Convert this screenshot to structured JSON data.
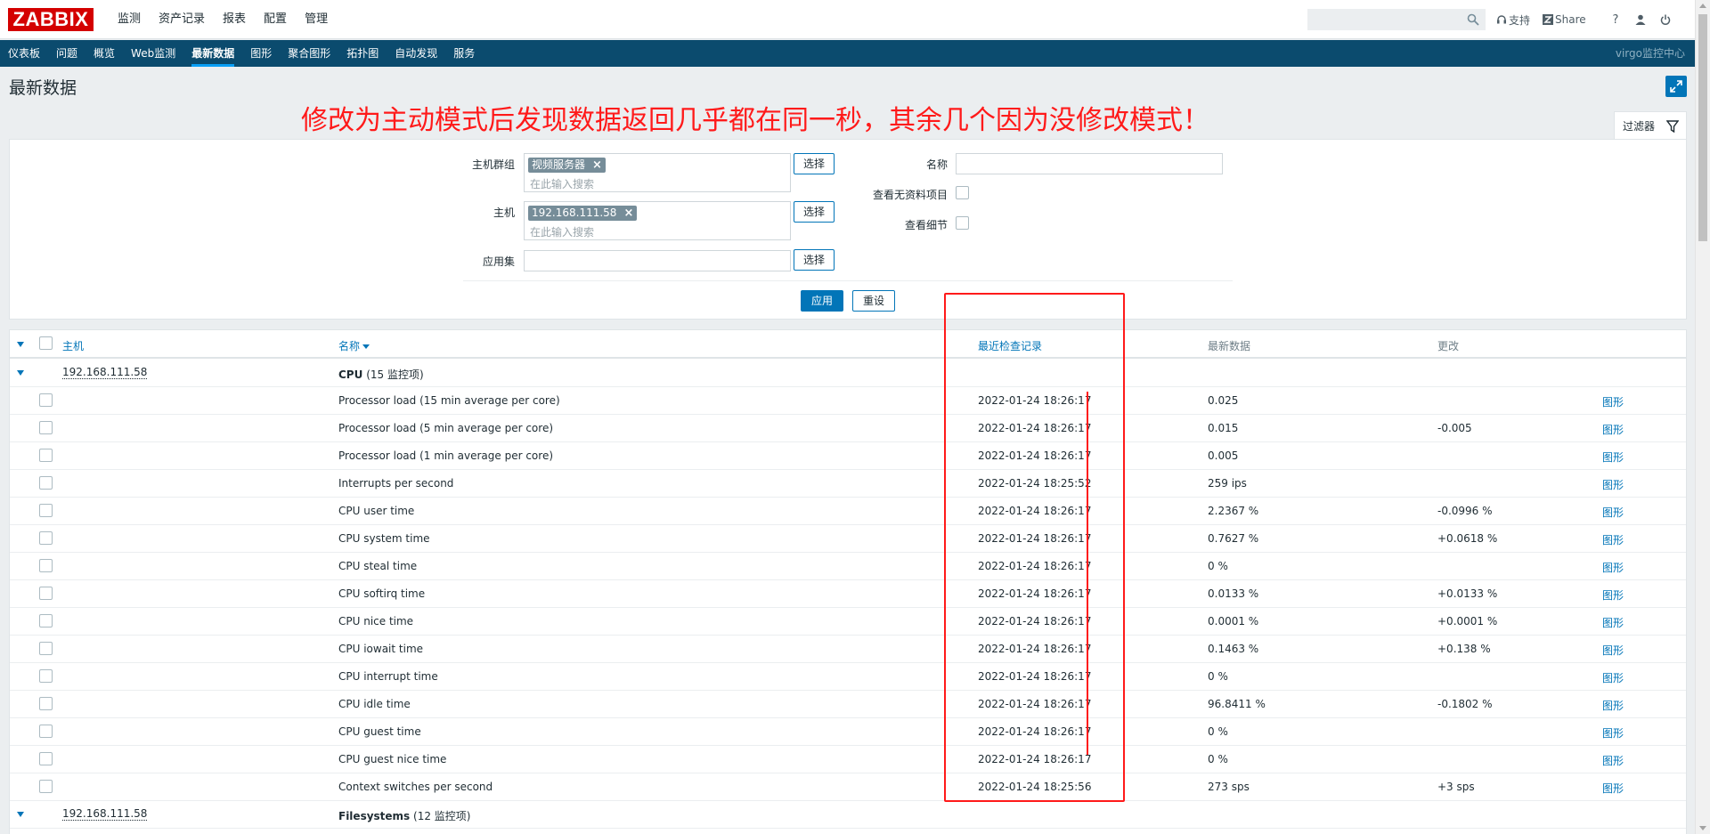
{
  "header": {
    "logo": "ZABBIX",
    "menu": [
      "监测",
      "资产记录",
      "报表",
      "配置",
      "管理"
    ],
    "search_placeholder": "",
    "links": {
      "support": "支持",
      "share": "Share"
    },
    "icons": {
      "help": "?"
    }
  },
  "subnav": {
    "items": [
      "仪表板",
      "问题",
      "概览",
      "Web监测",
      "最新数据",
      "图形",
      "聚合图形",
      "拓扑图",
      "自动发现",
      "服务"
    ],
    "active_index": 4,
    "server_name": "virgo监控中心"
  },
  "page": {
    "title": "最新数据",
    "annotation": "修改为主动模式后发现数据返回几乎都在同一秒，其余几个因为没修改模式！"
  },
  "filter": {
    "tab_label": "过滤器",
    "host_group_label": "主机群组",
    "host_group_chip": "视频服务器",
    "host_label": "主机",
    "host_chip": "192.168.111.58",
    "search_placeholder": "在此输入搜索",
    "app_label": "应用集",
    "select_label": "选择",
    "name_label": "名称",
    "show_without_data_label": "查看无资料项目",
    "show_details_label": "查看细节",
    "apply_label": "应用",
    "reset_label": "重设"
  },
  "table": {
    "columns": {
      "host": "主机",
      "name": "名称",
      "last_check": "最近检查记录",
      "last_value": "最新数据",
      "change": "更改"
    },
    "group1": {
      "host": "192.168.111.58",
      "app_name": "CPU",
      "app_count": "(15 监控项)"
    },
    "group2": {
      "host": "192.168.111.58",
      "app_name": "Filesystems",
      "app_count": "(12 监控项)"
    },
    "graph_label": "图形",
    "rows": [
      {
        "name": "Processor load (15 min average per core)",
        "time": "2022-01-24 18:26:17",
        "value": "0.025",
        "change": ""
      },
      {
        "name": "Processor load (5 min average per core)",
        "time": "2022-01-24 18:26:17",
        "value": "0.015",
        "change": "-0.005"
      },
      {
        "name": "Processor load (1 min average per core)",
        "time": "2022-01-24 18:26:17",
        "value": "0.005",
        "change": ""
      },
      {
        "name": "Interrupts per second",
        "time": "2022-01-24 18:25:52",
        "value": "259 ips",
        "change": ""
      },
      {
        "name": "CPU user time",
        "time": "2022-01-24 18:26:17",
        "value": "2.2367 %",
        "change": "-0.0996 %"
      },
      {
        "name": "CPU system time",
        "time": "2022-01-24 18:26:17",
        "value": "0.7627 %",
        "change": "+0.0618 %"
      },
      {
        "name": "CPU steal time",
        "time": "2022-01-24 18:26:17",
        "value": "0 %",
        "change": ""
      },
      {
        "name": "CPU softirq time",
        "time": "2022-01-24 18:26:17",
        "value": "0.0133 %",
        "change": "+0.0133 %"
      },
      {
        "name": "CPU nice time",
        "time": "2022-01-24 18:26:17",
        "value": "0.0001 %",
        "change": "+0.0001 %"
      },
      {
        "name": "CPU iowait time",
        "time": "2022-01-24 18:26:17",
        "value": "0.1463 %",
        "change": "+0.138 %"
      },
      {
        "name": "CPU interrupt time",
        "time": "2022-01-24 18:26:17",
        "value": "0 %",
        "change": ""
      },
      {
        "name": "CPU idle time",
        "time": "2022-01-24 18:26:17",
        "value": "96.8411 %",
        "change": "-0.1802 %"
      },
      {
        "name": "CPU guest time",
        "time": "2022-01-24 18:26:17",
        "value": "0 %",
        "change": ""
      },
      {
        "name": "CPU guest nice time",
        "time": "2022-01-24 18:26:17",
        "value": "0 %",
        "change": ""
      },
      {
        "name": "Context switches per second",
        "time": "2022-01-24 18:25:56",
        "value": "273 sps",
        "change": "+3 sps"
      }
    ]
  },
  "colors": {
    "logo_red": "#d40000",
    "nav_blue": "#0b4b6e",
    "link_blue": "#0275b8",
    "annotation_red": "#ff1a1a"
  }
}
